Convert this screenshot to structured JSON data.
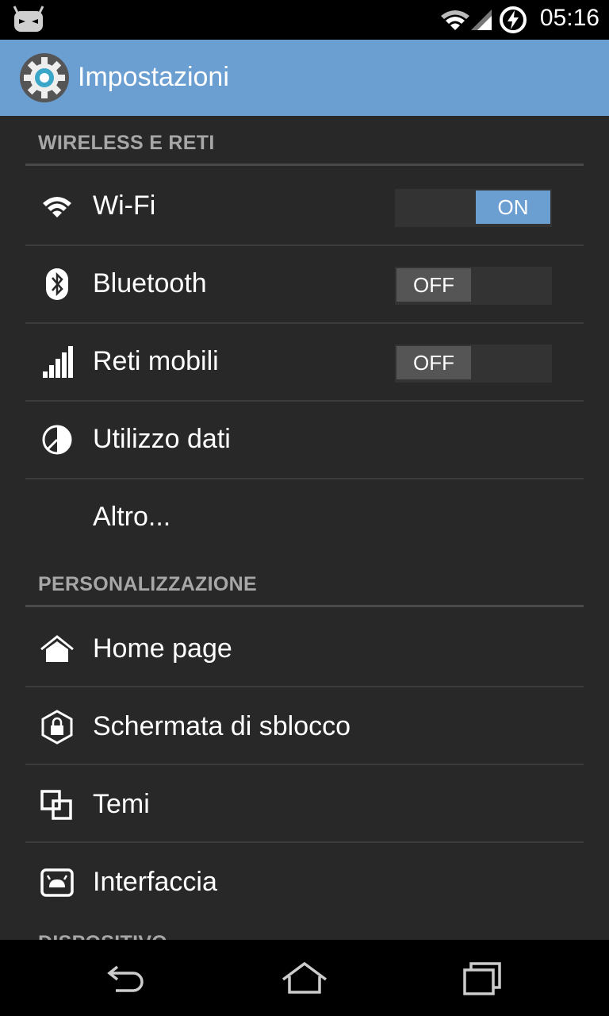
{
  "status_bar": {
    "time": "05:16",
    "icons": [
      "cyanogen-android-icon",
      "wifi-icon",
      "signal-icon",
      "battery-charging-icon"
    ]
  },
  "action_bar": {
    "title": "Impostazioni",
    "icon": "settings-gear-icon"
  },
  "sections": [
    {
      "header": "WIRELESS E RETI",
      "items": [
        {
          "label": "Wi-Fi",
          "icon": "wifi-icon",
          "toggle": "ON"
        },
        {
          "label": "Bluetooth",
          "icon": "bluetooth-icon",
          "toggle": "OFF"
        },
        {
          "label": "Reti mobili",
          "icon": "signal-bars-icon",
          "toggle": "OFF"
        },
        {
          "label": "Utilizzo dati",
          "icon": "data-usage-icon"
        },
        {
          "label": "Altro..."
        }
      ]
    },
    {
      "header": "PERSONALIZZAZIONE",
      "items": [
        {
          "label": "Home page",
          "icon": "home-icon"
        },
        {
          "label": "Schermata di sblocco",
          "icon": "lock-icon"
        },
        {
          "label": "Temi",
          "icon": "themes-icon"
        },
        {
          "label": "Interfaccia",
          "icon": "interface-icon"
        }
      ]
    },
    {
      "header": "DISPOSITIVO"
    }
  ],
  "nav_bar": {
    "buttons": [
      "back-icon",
      "home-icon",
      "recents-icon"
    ]
  },
  "colors": {
    "accent": "#6b9fd2",
    "background": "#282828",
    "header_text": "#a7a7a7"
  }
}
